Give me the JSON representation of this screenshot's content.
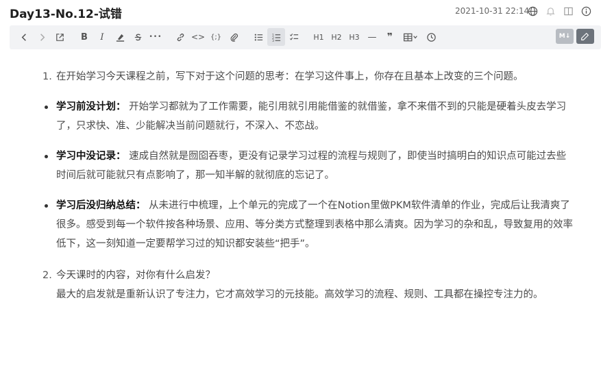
{
  "doc": {
    "title": "Day13-No.12-试错",
    "date": "2021-10-31 22:14"
  },
  "top_icons": [
    "globe-icon",
    "bell-icon",
    "split-view-icon",
    "info-icon"
  ],
  "toolbar": {
    "buttons": [
      "back-icon",
      "forward-icon",
      "open-external-icon",
      "bold",
      "italic",
      "highlight",
      "strikethrough",
      "more",
      "link",
      "code",
      "code-block",
      "attachment",
      "bullet-list",
      "ordered-list",
      "task-list",
      "H1",
      "H2",
      "H3",
      "horizontal-rule",
      "quote",
      "table",
      "history"
    ],
    "bold_label": "B",
    "italic_label": "I",
    "more_label": "•••",
    "code_label": "<>",
    "codeblock_label": "{;}",
    "h1_label": "H1",
    "h2_label": "H2",
    "h3_label": "H3",
    "hr_label": "—",
    "quote_label": "❞",
    "md_label": "M↓"
  },
  "content": {
    "item1": {
      "num": "1.",
      "text": "在开始学习今天课程之前，写下对于这个问题的思考：在学习这件事上，你存在且基本上改变的三个问题。"
    },
    "bullets": [
      {
        "label": "学习前没计划：",
        "text": "开始学习都就为了工作需要，能引用就引用能借鉴的就借鉴，拿不来借不到的只能是硬着头皮去学习了，只求快、准、少能解决当前问题就行，不深入、不恋战。"
      },
      {
        "label": "学习中没记录：",
        "text": "速成自然就是囫囵吞枣，更没有记录学习过程的流程与规则了，即使当时搞明白的知识点可能过去些时间后就可能就只有点影响了，那一知半解的就彻底的忘记了。"
      },
      {
        "label": "学习后没归纳总结：",
        "text": "从未进行中梳理，上个单元的完成了一个在Notion里做PKM软件清单的作业，完成后让我清爽了很多。感受到每一个软件按各种场景、应用、等分类方式整理到表格中那么清爽。因为学习的杂和乱，导致复用的效率低下，这一刻知道一定要帮学习过的知识都安装些“把手”。"
      }
    ],
    "item2": {
      "num": "2.",
      "question": "今天课时的内容，对你有什么启发？",
      "answer": "最大的启发就是重新认识了专注力，它才高效学习的元技能。高效学习的流程、规则、工具都在操控专注力的。"
    }
  }
}
